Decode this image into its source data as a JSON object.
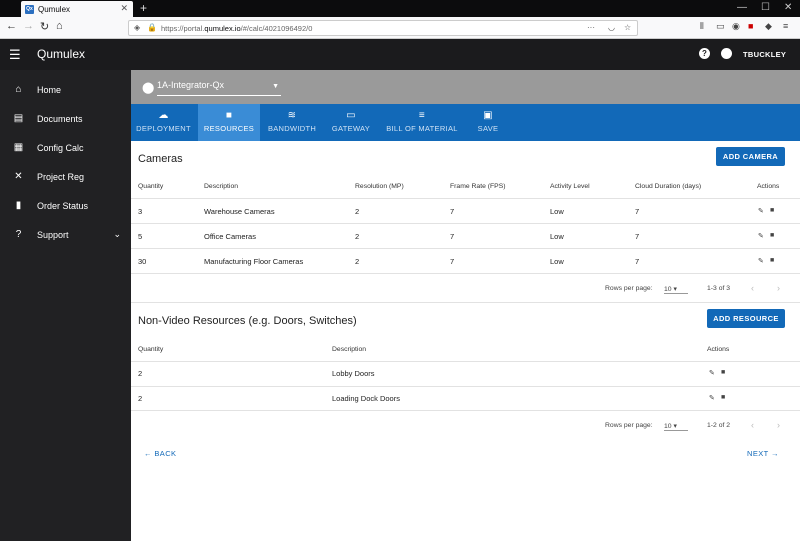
{
  "browser": {
    "tab_title": "Qumulex",
    "url_prefix": "https://portal.",
    "url_host": "qumulex.io",
    "url_path": "/#/calc/4021096492/0"
  },
  "app": {
    "brand": "Qumulex",
    "user": "TBUCKLEY"
  },
  "sidebar": {
    "items": [
      {
        "label": "Home",
        "icon": "home-icon"
      },
      {
        "label": "Documents",
        "icon": "document-icon"
      },
      {
        "label": "Config Calc",
        "icon": "calculator-icon"
      },
      {
        "label": "Project Reg",
        "icon": "tools-icon"
      },
      {
        "label": "Order Status",
        "icon": "truck-icon"
      },
      {
        "label": "Support",
        "icon": "help-icon"
      }
    ]
  },
  "location": {
    "value": "1A-Integrator-Qx"
  },
  "tabs": [
    {
      "label": "DEPLOYMENT",
      "icon": "cloud-icon"
    },
    {
      "label": "RESOURCES",
      "icon": "video-camera-icon",
      "active": true
    },
    {
      "label": "BANDWIDTH",
      "icon": "wifi-icon"
    },
    {
      "label": "GATEWAY",
      "icon": "router-icon"
    },
    {
      "label": "BILL OF MATERIAL",
      "icon": "list-icon"
    },
    {
      "label": "SAVE",
      "icon": "save-icon"
    }
  ],
  "cameras": {
    "title": "Cameras",
    "add_label": "ADD CAMERA",
    "headers": [
      "Quantity",
      "Description",
      "Resolution (MP)",
      "Frame Rate (FPS)",
      "Activity Level",
      "Cloud Duration (days)",
      "Actions"
    ],
    "rows": [
      [
        "3",
        "Warehouse Cameras",
        "2",
        "7",
        "Low",
        "7"
      ],
      [
        "5",
        "Office Cameras",
        "2",
        "7",
        "Low",
        "7"
      ],
      [
        "30",
        "Manufacturing Floor Cameras",
        "2",
        "7",
        "Low",
        "7"
      ]
    ],
    "rows_per_page_label": "Rows per page:",
    "rows_per_page": "10",
    "range": "1-3 of 3"
  },
  "resources": {
    "title": "Non-Video Resources (e.g. Doors, Switches)",
    "add_label": "ADD RESOURCE",
    "headers": [
      "Quantity",
      "Description",
      "Actions"
    ],
    "rows": [
      [
        "2",
        "Lobby Doors"
      ],
      [
        "2",
        "Loading Dock Doors"
      ]
    ],
    "rows_per_page_label": "Rows per page:",
    "rows_per_page": "10",
    "range": "1-2 of 2"
  },
  "footer": {
    "back": "BACK",
    "next": "NEXT"
  },
  "colors": {
    "primary": "#1269b8",
    "active_tab": "#3a8cd6",
    "sidebar": "#212123",
    "appbar": "#1b1b1d"
  }
}
